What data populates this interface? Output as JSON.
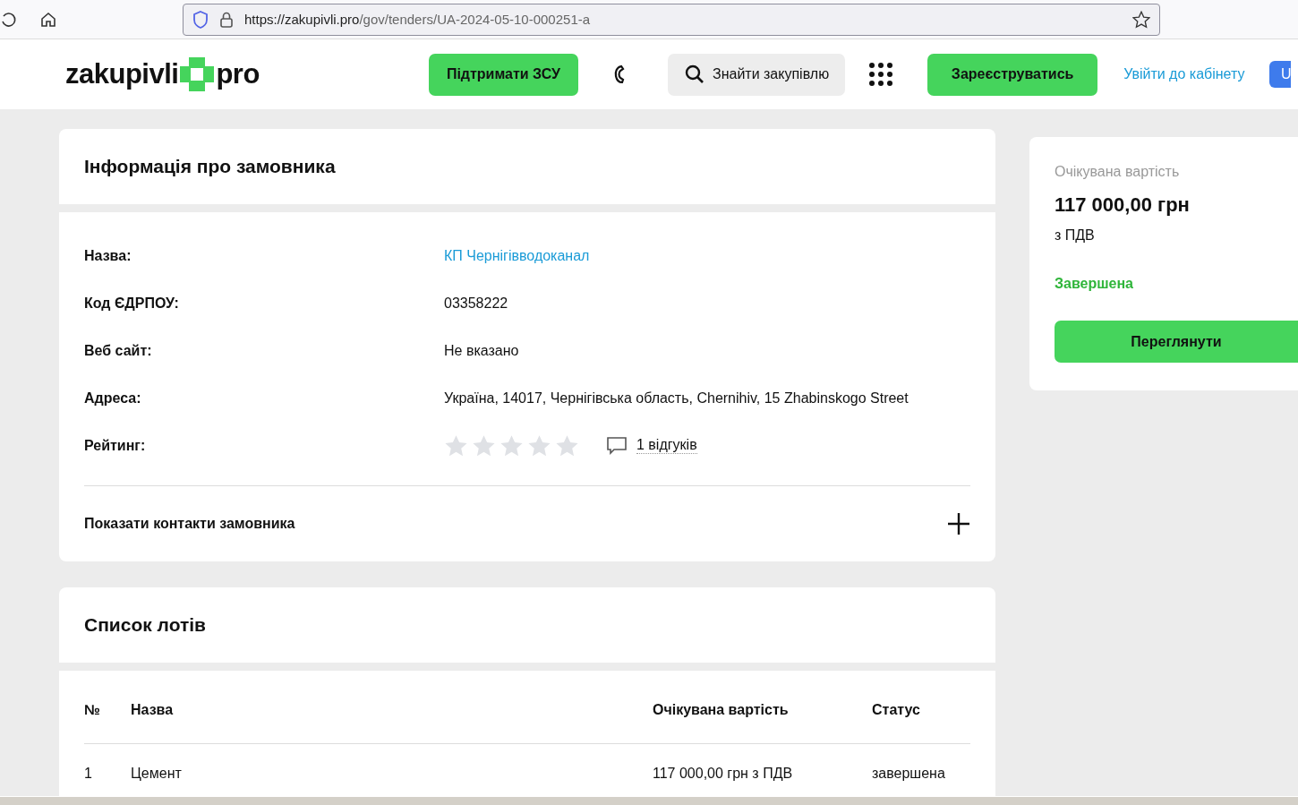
{
  "browser": {
    "url_host": "https://zakupivli.pro",
    "url_path": "/gov/tenders/UA-2024-05-10-000251-a"
  },
  "header": {
    "logo_left": "zakupivli",
    "logo_right": "pro",
    "support_button": "Підтримати ЗСУ",
    "search_button": "Знайти закупівлю",
    "register_button": "Зареєструватись",
    "login_link": "Увійти до кабінету",
    "avatar": "U"
  },
  "customer": {
    "title": "Інформація про замовника",
    "fields": [
      {
        "label": "Назва:",
        "value": "КП Чернігівводоканал",
        "kind": "link"
      },
      {
        "label": "Код ЄДРПОУ:",
        "value": "03358222",
        "kind": "text"
      },
      {
        "label": "Веб сайт:",
        "value": "Не вказано",
        "kind": "text"
      },
      {
        "label": "Адреса:",
        "value": "Україна, 14017, Чернігівська область, Chernihiv, 15 Zhabinskogo Street",
        "kind": "text"
      },
      {
        "label": "Рейтинг:",
        "stars": 0,
        "reviews": "1 відгуків",
        "kind": "rating"
      }
    ],
    "contacts": {
      "label": "Показати контакти замовника",
      "expanded": false
    }
  },
  "lots": {
    "title": "Список лотів",
    "columns": [
      "№",
      "Назва",
      "Очікувана вартість",
      "Статус"
    ],
    "rows": [
      {
        "number": "1",
        "name": "Цемент",
        "value": "117 000,00 грн з ПДВ",
        "status": "завершена"
      }
    ]
  },
  "summary": {
    "label": "Очікувана вартість",
    "amount": "117 000,00 грн",
    "vat": "з ПДВ",
    "status": "Завершена",
    "button": "Переглянути"
  }
}
